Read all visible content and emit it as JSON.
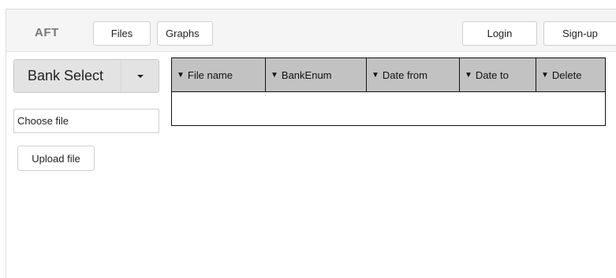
{
  "navbar": {
    "brand": "AFT",
    "files_label": "Files",
    "graphs_label": "Graphs",
    "login_label": "Login",
    "signup_label": "Sign-up"
  },
  "sidebar": {
    "bank_select_label": "Bank Select",
    "choose_file_label": "Choose  file",
    "upload_label": "Upload file"
  },
  "table": {
    "sort_icon": "triangle-down-icon",
    "columns": [
      "File name",
      "BankEnum",
      "Date from",
      "Date to",
      "Delete"
    ],
    "rows": []
  }
}
